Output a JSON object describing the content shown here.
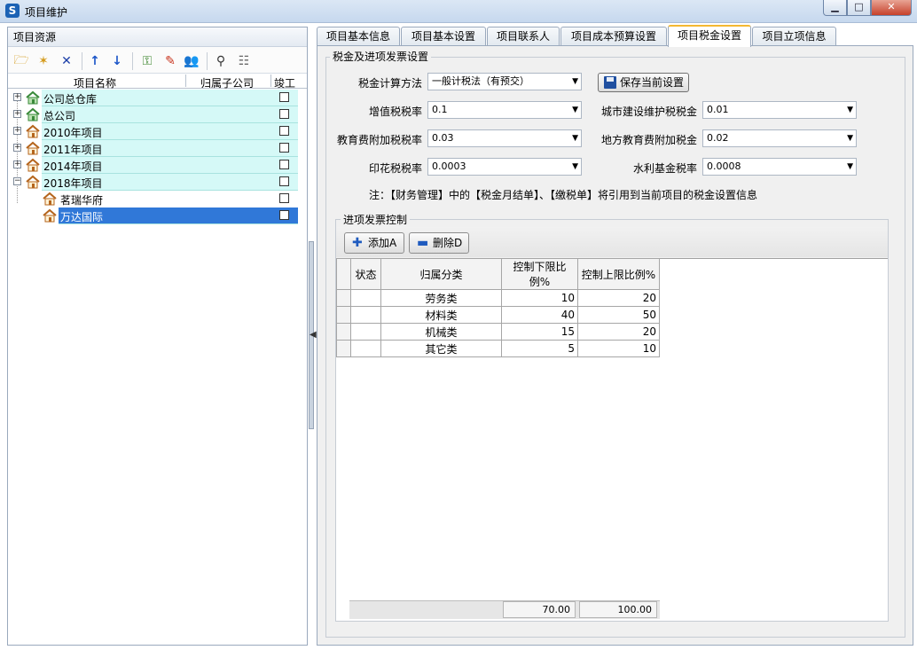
{
  "window": {
    "title": "项目维护"
  },
  "left": {
    "header": "项目资源",
    "columns": {
      "name": "项目名称",
      "company": "归属子公司",
      "done": "竣工"
    },
    "tree": [
      {
        "label": "公司总仓库",
        "level": 0,
        "icon": "house-green-icon",
        "expander": "+"
      },
      {
        "label": "总公司",
        "level": 0,
        "icon": "house-green-icon",
        "expander": "+"
      },
      {
        "label": "2010年项目",
        "level": 0,
        "icon": "house-icon",
        "expander": "+"
      },
      {
        "label": "2011年项目",
        "level": 0,
        "icon": "house-icon",
        "expander": "+"
      },
      {
        "label": "2014年项目",
        "level": 0,
        "icon": "house-icon",
        "expander": "+"
      },
      {
        "label": "2018年项目",
        "level": 0,
        "icon": "house-icon",
        "expander": "-"
      },
      {
        "label": "茗瑞华府",
        "level": 1,
        "icon": "house-icon"
      },
      {
        "label": "万达国际",
        "level": 1,
        "icon": "house-icon",
        "selected": true
      }
    ]
  },
  "tabs": [
    {
      "label": "项目基本信息"
    },
    {
      "label": "项目基本设置"
    },
    {
      "label": "项目联系人"
    },
    {
      "label": "项目成本预算设置"
    },
    {
      "label": "项目税金设置",
      "active": true
    },
    {
      "label": "项目立项信息"
    }
  ],
  "tax": {
    "group_title": "税金及进项发票设置",
    "method_label": "税金计算方法",
    "method_value": "一般计税法（有预交）",
    "save_label": "保存当前设置",
    "vat_label": "增值税税率",
    "vat_value": "0.1",
    "city_label": "城市建设维护税税金",
    "city_value": "0.01",
    "edu_label": "教育费附加税税率",
    "edu_value": "0.03",
    "local_edu_label": "地方教育费附加税金",
    "local_edu_value": "0.02",
    "stamp_label": "印花税税率",
    "stamp_value": "0.0003",
    "water_label": "水利基金税率",
    "water_value": "0.0008",
    "note": "注：【财务管理】中的【税金月结单】、【缴税单】将引用到当前项目的税金设置信息"
  },
  "invoice": {
    "title": "进项发票控制",
    "add_label": "添加A",
    "delete_label": "删除D",
    "columns": {
      "status": "状态",
      "category": "归属分类",
      "lower": "控制下限比例%",
      "upper": "控制上限比例%"
    },
    "rows": [
      {
        "category": "劳务类",
        "lower": "10",
        "upper": "20"
      },
      {
        "category": "材料类",
        "lower": "40",
        "upper": "50"
      },
      {
        "category": "机械类",
        "lower": "15",
        "upper": "20"
      },
      {
        "category": "其它类",
        "lower": "5",
        "upper": "10"
      }
    ],
    "total_lower": "70.00",
    "total_upper": "100.00"
  }
}
